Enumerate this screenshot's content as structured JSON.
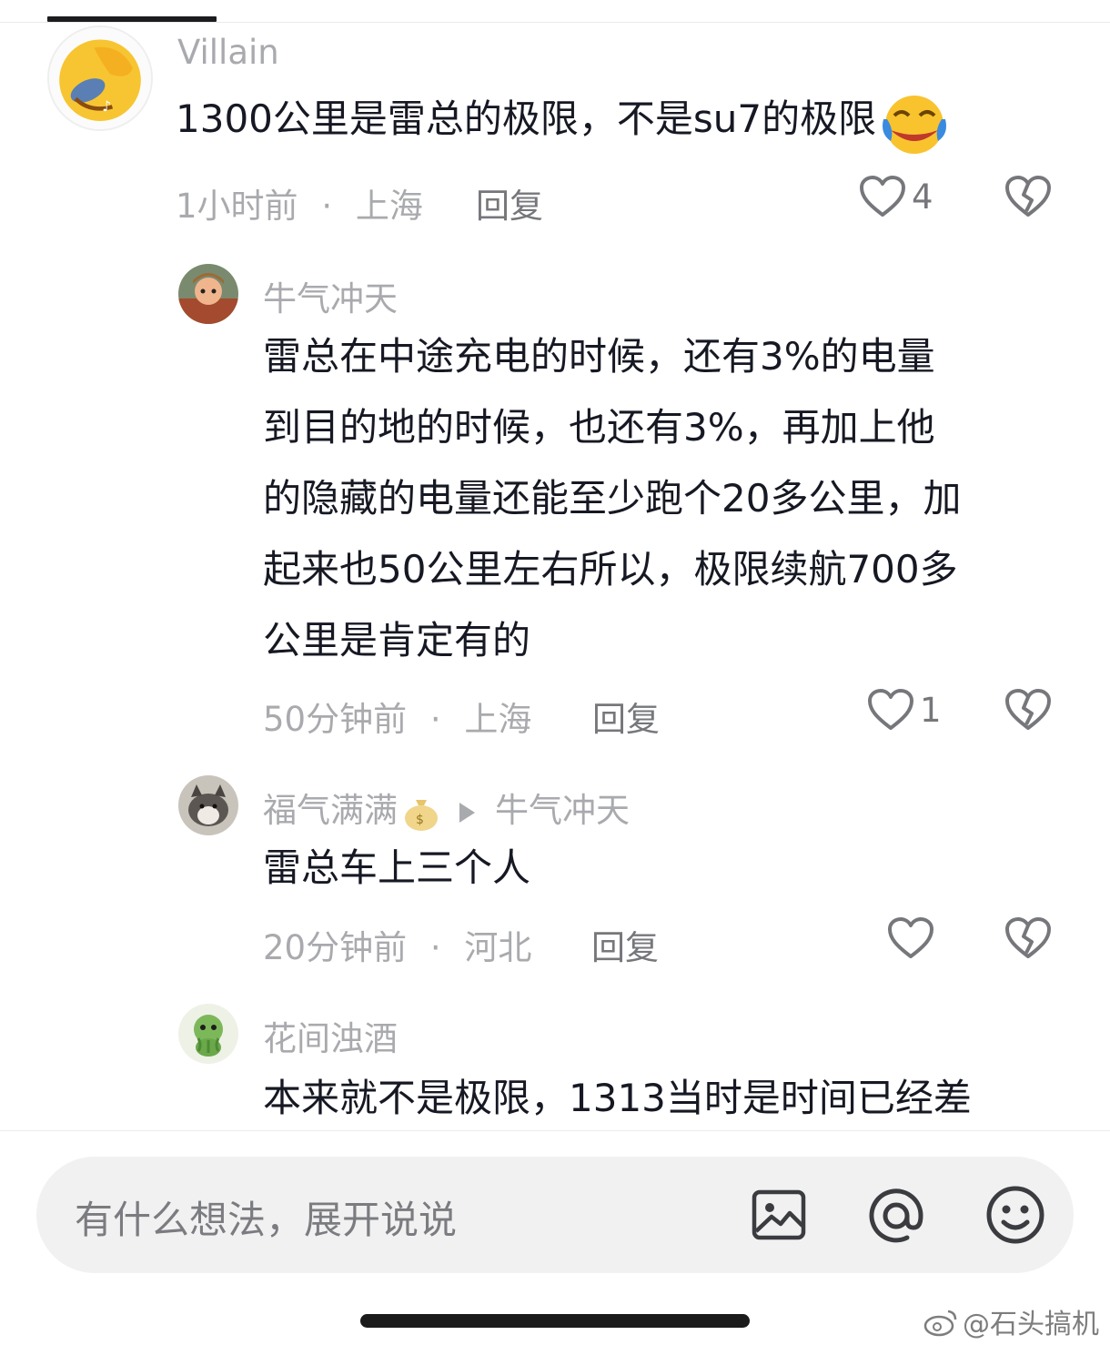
{
  "comments": [
    {
      "username": "Villain",
      "text_lines": [
        "1300公里是雷总的极限，不是su7的极限"
      ],
      "time": "1小时前",
      "location": "上海",
      "reply": "回复",
      "likes": "4"
    },
    {
      "username": "牛气冲天",
      "text_lines": [
        "雷总在中途充电的时候，还有3%的电量",
        "到目的地的时候，也还有3%，再加上他",
        "的隐藏的电量还能至少跑个20多公里，加",
        "起来也50公里左右所以，极限续航700多",
        "公里是肯定有的"
      ],
      "time": "50分钟前",
      "location": "上海",
      "reply": "回复",
      "likes": "1"
    },
    {
      "username": "福气满满",
      "reply_to": "牛气冲天",
      "text_lines": [
        "雷总车上三个人"
      ],
      "time": "20分钟前",
      "location": "河北",
      "reply": "回复",
      "likes": ""
    },
    {
      "username": "花间浊酒",
      "text_lines": [
        "本来就不是极限，1313当时是时间已经差"
      ]
    }
  ],
  "input": {
    "placeholder": "有什么想法，展开说说"
  },
  "watermark": "@石头搞机",
  "meta_separator": "·",
  "icons": {
    "like": "heart-outline-icon",
    "dislike": "broken-heart-icon",
    "image": "image-icon",
    "mention": "at-sign-icon",
    "emoji": "smiley-icon"
  },
  "colors": {
    "text_primary": "#161823",
    "text_secondary": "#a9aaae",
    "input_bg": "#f1f1f2"
  }
}
